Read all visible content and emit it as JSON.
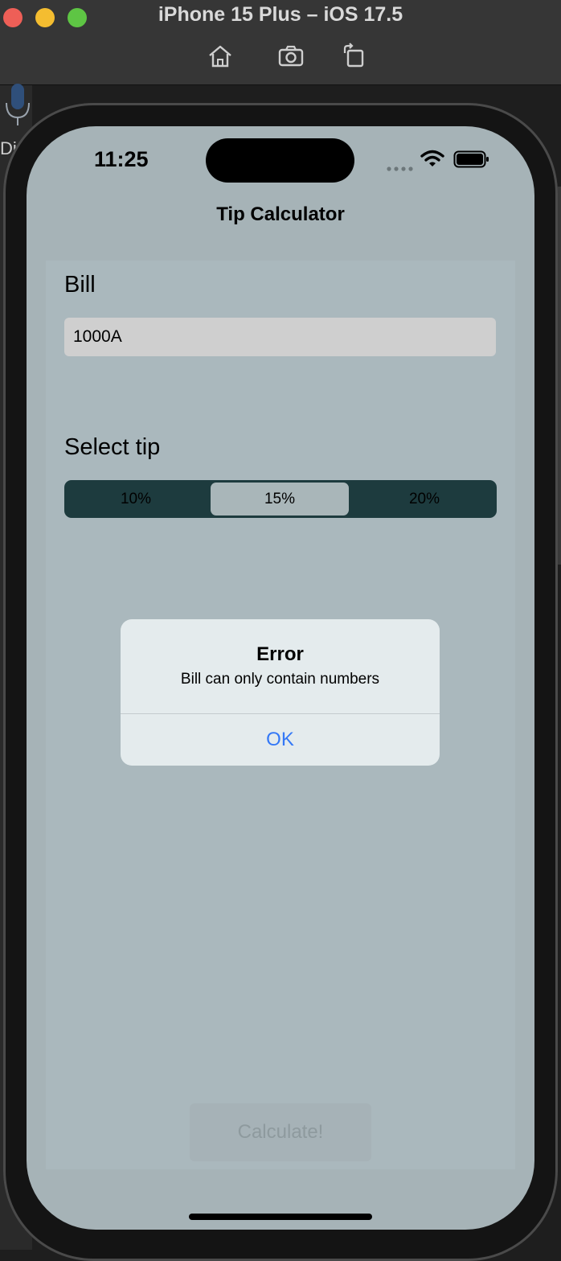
{
  "window": {
    "title": "iPhone 15 Plus – iOS 17.5"
  },
  "toolbar": {
    "home_icon": "home-icon",
    "screenshot_icon": "camera-icon",
    "rotate_icon": "rotate-icon"
  },
  "background": {
    "partial_label": "Dic"
  },
  "status_bar": {
    "time": "11:25"
  },
  "nav": {
    "title": "Tip Calculator"
  },
  "form": {
    "bill_label": "Bill",
    "bill_value": "1000A",
    "tip_label": "Select tip",
    "tip_options": [
      "10%",
      "15%",
      "20%"
    ],
    "selected_tip": "15%",
    "calculate_label": "Calculate!"
  },
  "alert": {
    "title": "Error",
    "message": "Bill can only contain numbers",
    "ok_label": "OK"
  },
  "colors": {
    "screen_bg": "#a6b3b7",
    "segment_bg": "#1d3b3e",
    "alert_bg": "#e4ebed",
    "link_blue": "#3478f6"
  }
}
